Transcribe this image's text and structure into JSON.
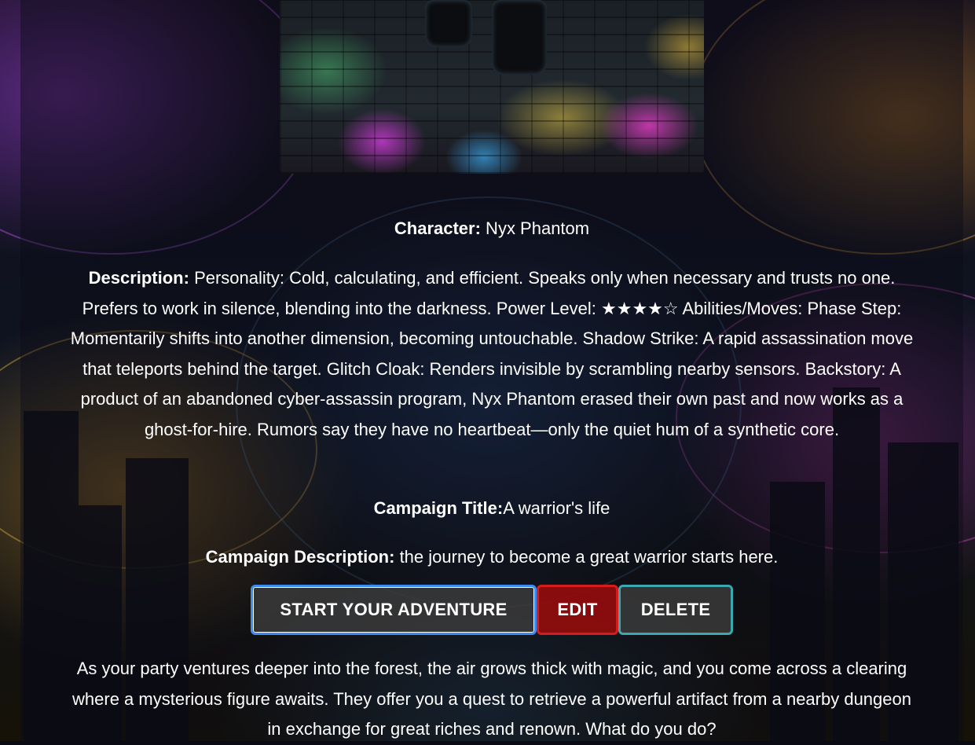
{
  "character": {
    "label": "Character:",
    "value": " Nyx Phantom"
  },
  "description": {
    "label": "Description:",
    "value": " Personality: Cold, calculating, and efficient. Speaks only when necessary and trusts no one. Prefers to work in silence, blending into the darkness. Power Level: ★★★★☆ Abilities/Moves: Phase Step: Momentarily shifts into another dimension, becoming untouchable. Shadow Strike: A rapid assassination move that teleports behind the target. Glitch Cloak: Renders invisible by scrambling nearby sensors. Backstory: A product of an abandoned cyber-assassin program, Nyx Phantom erased their own past and now works as a ghost-for-hire. Rumors say they have no heartbeat—only the quiet hum of a synthetic core."
  },
  "campaign": {
    "title_label": "Campaign Title:",
    "title_value": "A warrior's life",
    "description_label": "Campaign Description:",
    "description_value": " the journey to become a great warrior starts here."
  },
  "actions": {
    "start_label": "START YOUR ADVENTURE",
    "edit_label": "EDIT",
    "delete_label": "DELETE"
  },
  "story": {
    "text": "As your party ventures deeper into the forest, the air grows thick with magic, and you come across a clearing where a mysterious figure awaits. They offer you a quest to retrieve a powerful artifact from a nearby dungeon in exchange for great riches and renown. What do you do?"
  },
  "colors": {
    "start_border": "#3b8cf2",
    "edit_background": "#960c0c",
    "edit_border": "#d41e1e",
    "delete_border": "#3ba8b0",
    "text": "#ffffff"
  },
  "icons": {
    "background": "cyberpunk-character-background-image",
    "hero": "character-portrait-image"
  }
}
